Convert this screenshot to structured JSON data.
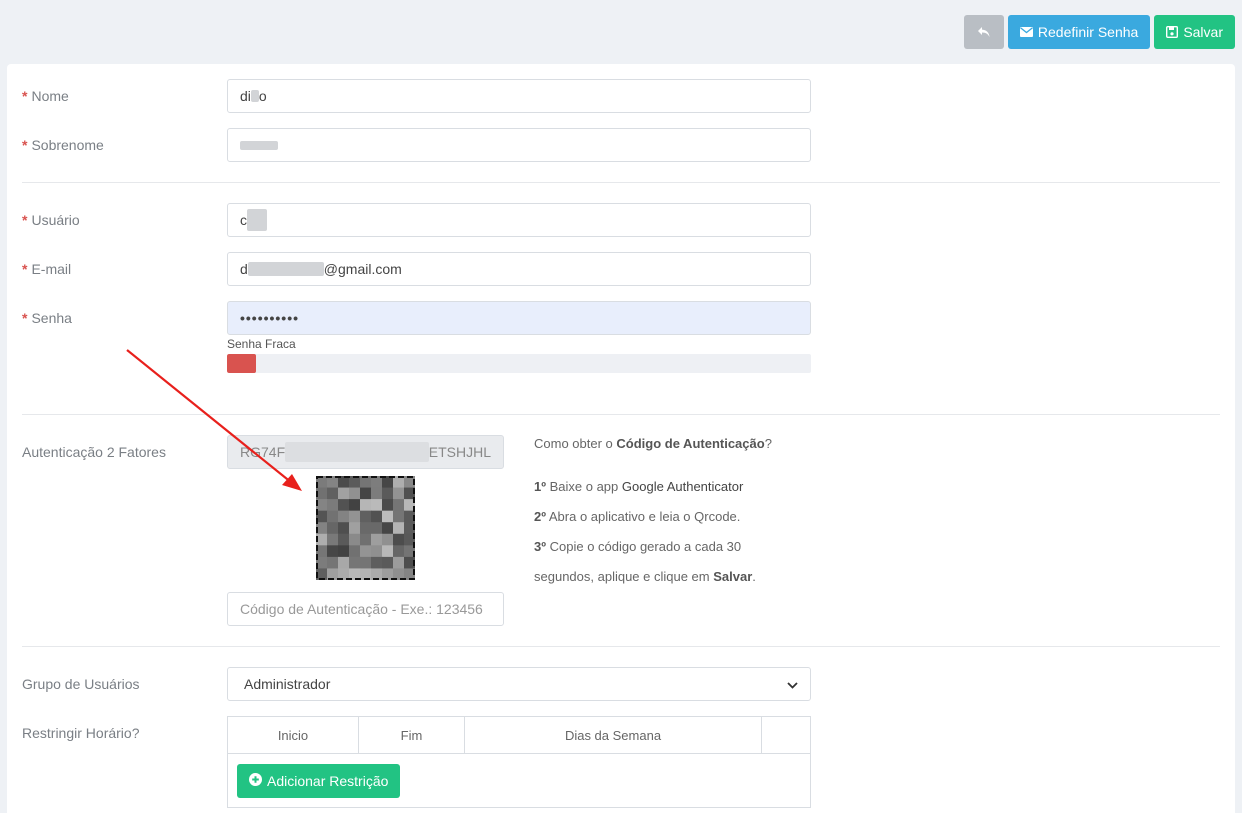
{
  "toolbar": {
    "back_icon": "undo-arrow-icon",
    "reset_password_label": "Redefinir Senha",
    "save_label": "Salvar"
  },
  "form": {
    "nome": {
      "label": "Nome",
      "value_prefix": "di",
      "value_suffix": "o"
    },
    "sobrenome": {
      "label": "Sobrenome"
    },
    "usuario": {
      "label": "Usuário",
      "value_prefix": "c"
    },
    "email": {
      "label": "E-mail",
      "value_prefix": "d",
      "value_suffix": "@gmail.com"
    },
    "senha": {
      "label": "Senha",
      "value": "••••••••••",
      "strength_label": "Senha Fraca",
      "strength": 0.05
    },
    "two_factor": {
      "label": "Autenticação 2 Fatores",
      "secret_prefix": "RG74F",
      "secret_suffix": "ETSHJHL",
      "code_placeholder": "Código de Autenticação - Exe.: 123456"
    },
    "grupo": {
      "label": "Grupo de Usuários",
      "value": "Administrador"
    },
    "restringir": {
      "label": "Restringir Horário?",
      "columns": [
        "Inicio",
        "Fim",
        "Dias da Semana",
        ""
      ],
      "add_label": "Adicionar Restrição"
    }
  },
  "help": {
    "q_prefix": "Como obter o ",
    "q_bold": "Código de Autenticação",
    "q_suffix": "?",
    "step1_num": "1º",
    "step1_text": "Baixe o app ",
    "step1_app": "Google Authenticator",
    "step2_num": "2º",
    "step2_text": "Abra o aplicativo e leia o Qrcode.",
    "step3_num": "3º",
    "step3_text": "Copie o código gerado a cada 30",
    "step3b_text": "segundos, aplique e clique em ",
    "step3b_bold": "Salvar",
    "step3b_end": "."
  },
  "colors": {
    "primary_blue": "#3aa9df",
    "success_green": "#22c383",
    "danger_red": "#d9534f",
    "annotation_arrow": "#e8201c"
  }
}
